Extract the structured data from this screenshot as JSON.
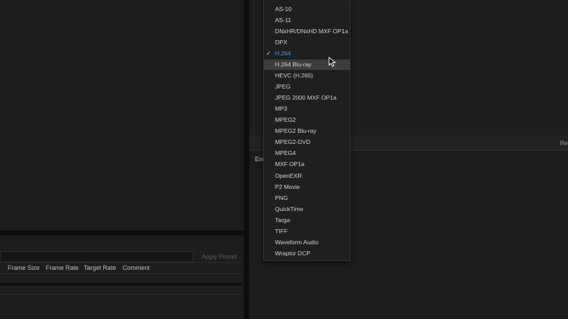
{
  "right_bar": {
    "label": "Re"
  },
  "encode": {
    "label": "Enc"
  },
  "preset": {
    "apply_label": "Apply Preset"
  },
  "queue_columns": [
    "Frame Size",
    "Frame Rate",
    "Target Rate",
    "Comment"
  ],
  "format_menu": {
    "partial_top_label": "AS-10 ...",
    "items": [
      {
        "label": "AS-10"
      },
      {
        "label": "AS-11"
      },
      {
        "label": "DNxHR/DNxHD MXF OP1a"
      },
      {
        "label": "DPX"
      },
      {
        "label": "H.264"
      },
      {
        "label": "H.264 Blu-ray"
      },
      {
        "label": "HEVC (H.265)"
      },
      {
        "label": "JPEG"
      },
      {
        "label": "JPEG 2000 MXF OP1a"
      },
      {
        "label": "MP3"
      },
      {
        "label": "MPEG2"
      },
      {
        "label": "MPEG2 Blu-ray"
      },
      {
        "label": "MPEG2-DVD"
      },
      {
        "label": "MPEG4"
      },
      {
        "label": "MXF OP1a"
      },
      {
        "label": "OpenEXR"
      },
      {
        "label": "P2 Movie"
      },
      {
        "label": "PNG"
      },
      {
        "label": "QuickTime"
      },
      {
        "label": "Targa"
      },
      {
        "label": "TIFF"
      },
      {
        "label": "Waveform Audio"
      },
      {
        "label": "Wraptor DCP"
      }
    ],
    "selected": "H.264",
    "hovered": "H.264 Blu-ray"
  },
  "colors": {
    "selected_text": "#4a9fe6",
    "hover_bg": "#3d3d3d"
  }
}
